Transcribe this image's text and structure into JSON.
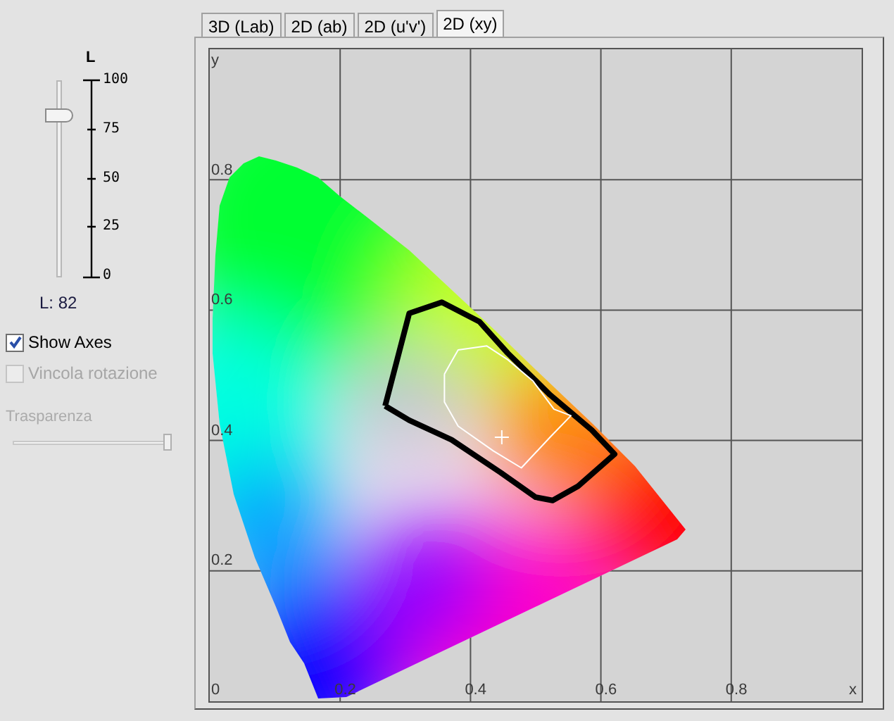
{
  "side_panel": {
    "axis_label": "L",
    "slider": {
      "level": 0.82
    },
    "scale_labels": [
      "100",
      "75",
      "50",
      "25",
      "0"
    ],
    "reading": "L: 82",
    "options": [
      {
        "label": "Show Axes",
        "checked": true,
        "disabled": false
      },
      {
        "label": "Vincola rotazione",
        "checked": false,
        "disabled": true
      }
    ],
    "transparency": {
      "label": "Trasparenza",
      "level": 1,
      "disabled": true
    }
  },
  "tabs": [
    {
      "label": "3D (Lab)",
      "selected": false
    },
    {
      "label": "2D (ab)",
      "selected": false
    },
    {
      "label": "2D (u'v')",
      "selected": false
    },
    {
      "label": "2D (xy)",
      "selected": true
    }
  ],
  "plot": {
    "chart_data": {
      "type": "line",
      "grid": true,
      "xlabel": "x",
      "ylabel": "y",
      "xlim": [
        0,
        1
      ],
      "ylim": [
        0,
        1
      ],
      "xticks": [
        {
          "value": 0,
          "label": "0"
        },
        {
          "value": 0.2,
          "label": "0.2"
        },
        {
          "value": 0.4,
          "label": "0.4"
        },
        {
          "value": 0.6,
          "label": "0.6"
        },
        {
          "value": 0.8,
          "label": "0.8"
        }
      ],
      "yticks": [
        {
          "value": 0.2,
          "label": "0.2"
        },
        {
          "value": 0.4,
          "label": "0.4"
        },
        {
          "value": 0.6,
          "label": "0.6"
        },
        {
          "value": 0.8,
          "label": "0.8"
        }
      ]
    }
  }
}
